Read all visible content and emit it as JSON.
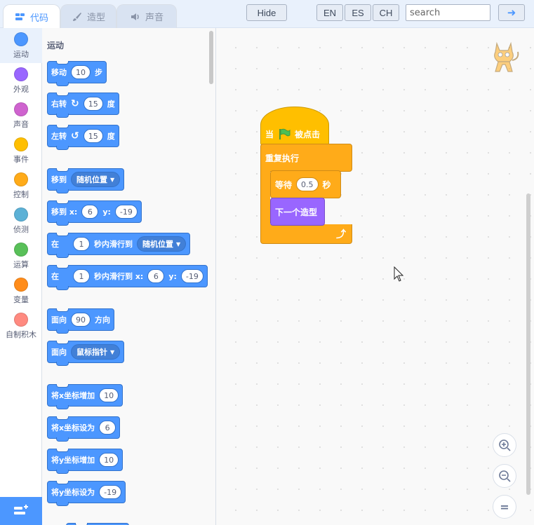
{
  "tabs": [
    {
      "label": "代码",
      "active": true,
      "icon": "code-icon"
    },
    {
      "label": "造型",
      "active": false,
      "icon": "costume-brush-icon"
    },
    {
      "label": "声音",
      "active": false,
      "icon": "speaker-icon"
    }
  ],
  "toolbar": {
    "hide_label": "Hide",
    "languages": [
      "EN",
      "ES",
      "CH"
    ],
    "search_placeholder": "search",
    "go_icon": "arrow-right-icon"
  },
  "categories": [
    {
      "label": "运动",
      "color": "#4c97ff"
    },
    {
      "label": "外观",
      "color": "#9966ff"
    },
    {
      "label": "声音",
      "color": "#cf63cf"
    },
    {
      "label": "事件",
      "color": "#ffbf00"
    },
    {
      "label": "控制",
      "color": "#ffab19"
    },
    {
      "label": "侦测",
      "color": "#5cb1d6"
    },
    {
      "label": "运算",
      "color": "#59c059"
    },
    {
      "label": "变量",
      "color": "#ff8c1a"
    },
    {
      "label": "自制积木",
      "color": "#ff6680"
    }
  ],
  "palette": {
    "title": "运动",
    "blocks": {
      "move": {
        "pre": "移动",
        "steps": "10",
        "post": "步"
      },
      "turn_right": {
        "pre": "右转",
        "deg": "15",
        "post": "度"
      },
      "turn_left": {
        "pre": "左转",
        "deg": "15",
        "post": "度"
      },
      "goto": {
        "pre": "移到",
        "target": "随机位置"
      },
      "goto_xy": {
        "pre": "移到 x:",
        "x": "6",
        "ylabel": "y:",
        "y": "-19"
      },
      "glide": {
        "pre": "在",
        "secs": "1",
        "mid": "秒内滑行到",
        "target": "随机位置"
      },
      "glide_xy": {
        "pre": "在",
        "secs": "1",
        "mid": "秒内滑行到 x:",
        "x": "6",
        "ylabel": "y:",
        "y": "-19"
      },
      "point_dir": {
        "pre": "面向",
        "dir": "90",
        "post": "方向"
      },
      "point_towards": {
        "pre": "面向",
        "target": "鼠标指针"
      },
      "change_x": {
        "pre": "将x坐标增加",
        "val": "10"
      },
      "set_x": {
        "pre": "将x坐标设为",
        "val": "6"
      },
      "change_y": {
        "pre": "将y坐标增加",
        "val": "10"
      },
      "set_y": {
        "pre": "将y坐标设为",
        "val": "-19"
      }
    }
  },
  "script": {
    "hat": {
      "pre": "当",
      "post": "被点击",
      "icon": "green-flag-icon"
    },
    "repeat": {
      "label": "重复执行"
    },
    "wait": {
      "pre": "等待",
      "secs": "0.5",
      "post": "秒"
    },
    "next_costume": {
      "label": "下一个造型"
    }
  },
  "zoom": {
    "in": "+",
    "out": "−",
    "reset": "="
  }
}
